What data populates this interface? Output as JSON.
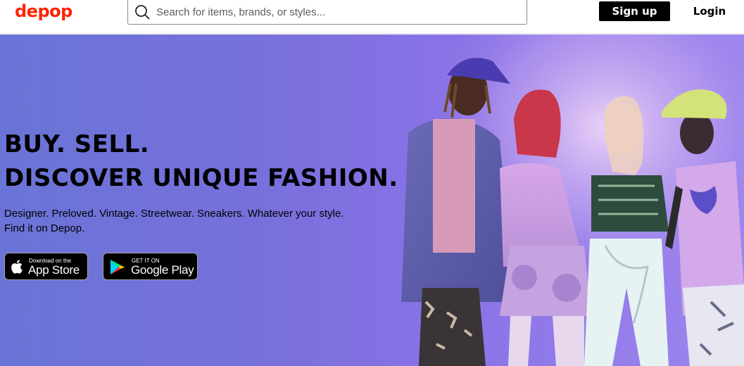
{
  "header": {
    "logo": "depop",
    "search_placeholder": "Search for items, brands, or styles...",
    "signup_label": "Sign up",
    "login_label": "Login"
  },
  "hero": {
    "headline_line1": "BUY. SELL.",
    "headline_line2": "DISCOVER UNIQUE FASHION.",
    "subtext": "Designer. Preloved. Vintage. Streetwear. Sneakers. Whatever your style. Find it on Depop.",
    "app_store": {
      "small": "Download on the",
      "big": "App Store",
      "icon": "apple-icon"
    },
    "google_play": {
      "small": "GET IT ON",
      "big": "Google Play",
      "icon": "google-play-icon"
    },
    "image_subject": "group of four young people in colourful streetwear"
  },
  "colors": {
    "brand": "#ff2300",
    "hero_background": "#7770dc",
    "button_dark": "#000000"
  }
}
